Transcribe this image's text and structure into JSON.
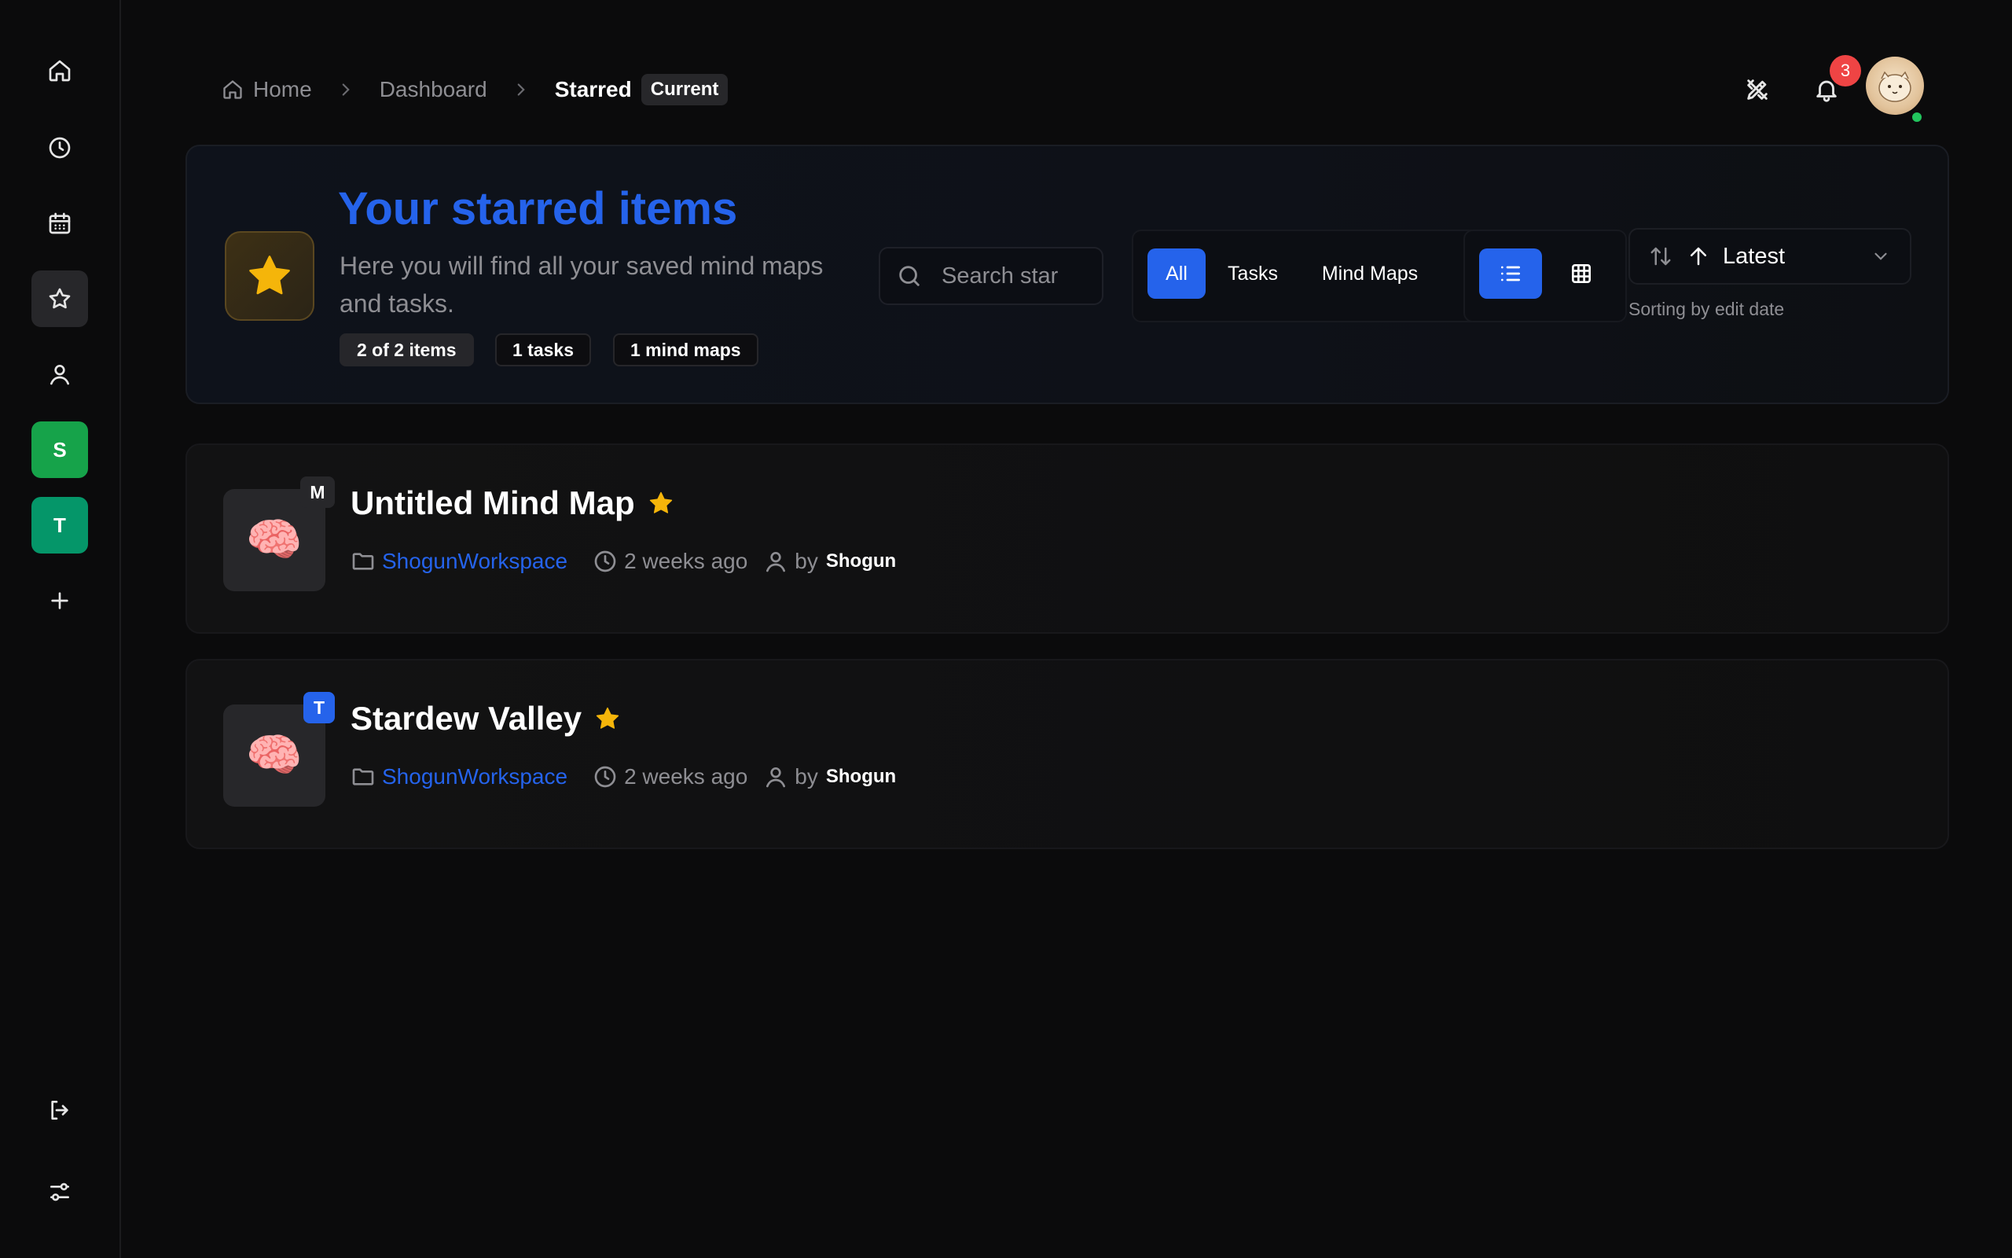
{
  "sidebar": {
    "workspaces": [
      {
        "letter": "S",
        "color": "#16a34a"
      },
      {
        "letter": "T",
        "color": "#059669"
      }
    ]
  },
  "breadcrumb": {
    "home": "Home",
    "dashboard": "Dashboard",
    "current": "Starred",
    "current_badge": "Current"
  },
  "header": {
    "notification_count": "3"
  },
  "hero": {
    "title": "Your starred items",
    "subtitle": "Here you will find all your saved mind maps and tasks.",
    "chips": [
      "2 of 2 items",
      "1 tasks",
      "1 mind maps"
    ],
    "search_placeholder": "Search starred...",
    "filters": [
      "All",
      "Tasks",
      "Mind Maps"
    ],
    "active_filter": "All",
    "active_view": "list",
    "sort_label": "Latest",
    "sort_hint": "Sorting by edit date"
  },
  "items": [
    {
      "title": "Untitled Mind Map",
      "type_badge": "M",
      "workspace": "ShogunWorkspace",
      "time": "2 weeks ago",
      "by": "by",
      "author": "Shogun",
      "starred": true
    },
    {
      "title": "Stardew Valley",
      "type_badge": "T",
      "workspace": "ShogunWorkspace",
      "time": "2 weeks ago",
      "by": "by",
      "author": "Shogun",
      "starred": true
    }
  ],
  "colors": {
    "accent": "#2563eb",
    "star": "#f5b50a",
    "badge_red": "#ef4444",
    "online": "#22c55e"
  }
}
